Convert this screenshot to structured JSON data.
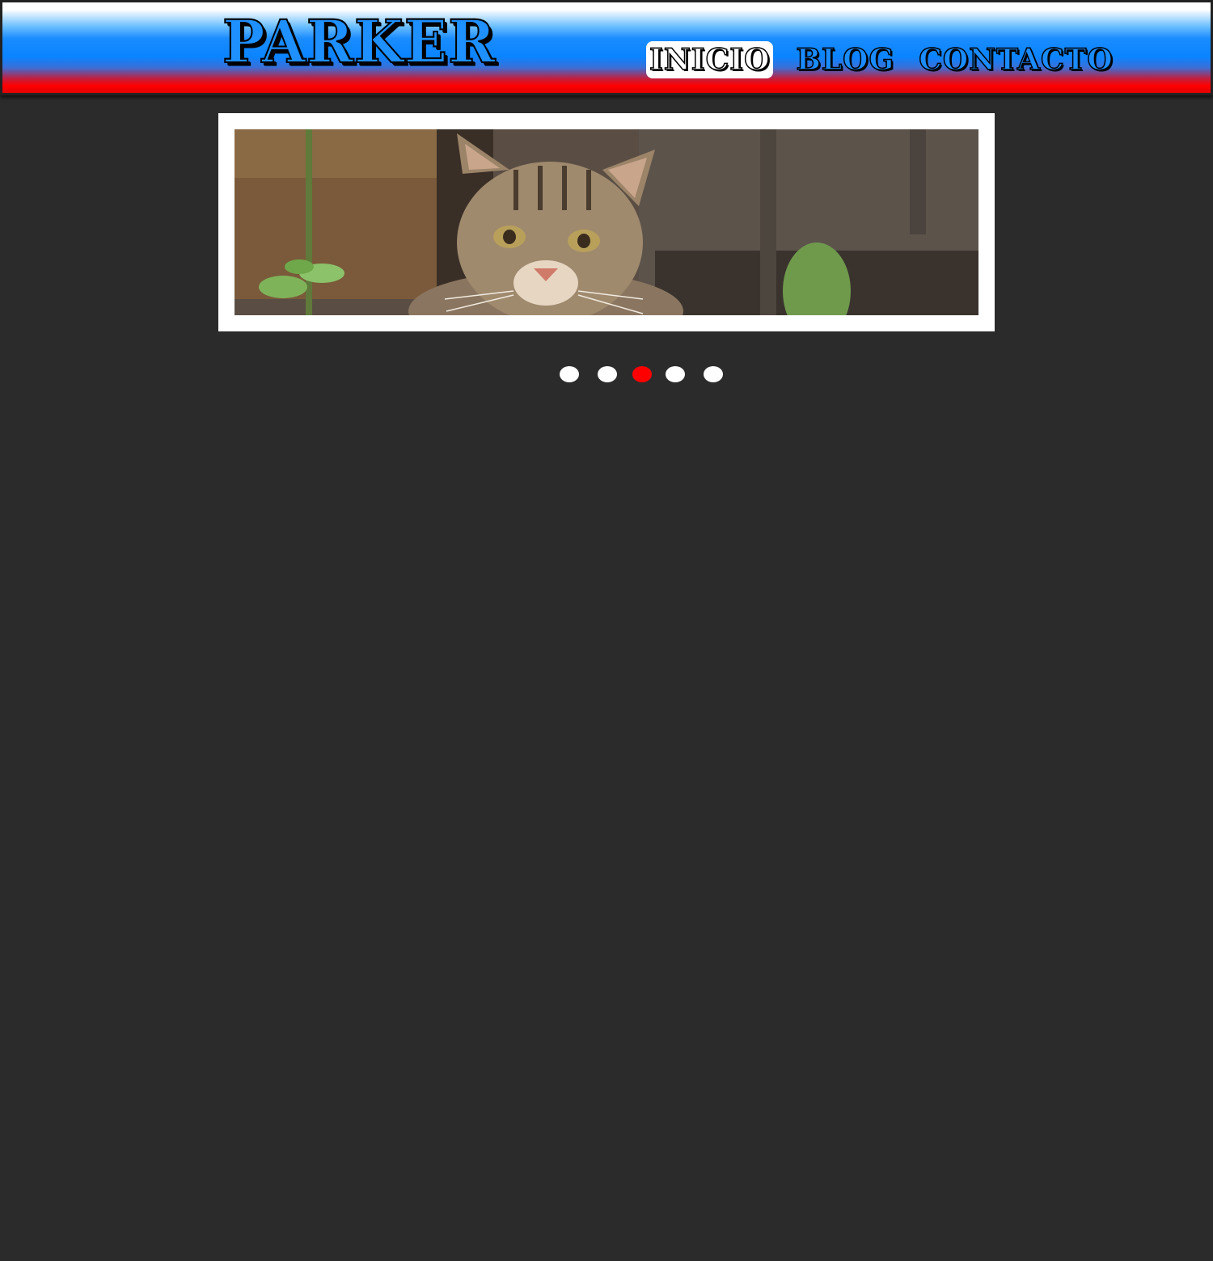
{
  "header": {
    "logo_text": "PARKER",
    "nav": [
      {
        "label": "INICIO",
        "active": true
      },
      {
        "label": "BLOG",
        "active": false
      },
      {
        "label": "CONTACTO",
        "active": false
      }
    ]
  },
  "slider": {
    "total_slides": 5,
    "active_index": 3,
    "active_dot_color": "#ff0000",
    "inactive_dot_color": "#ffffff"
  },
  "colors": {
    "page_background": "#2b2b2b",
    "header_blue": "#0a84ff",
    "header_red": "#ff0000"
  }
}
